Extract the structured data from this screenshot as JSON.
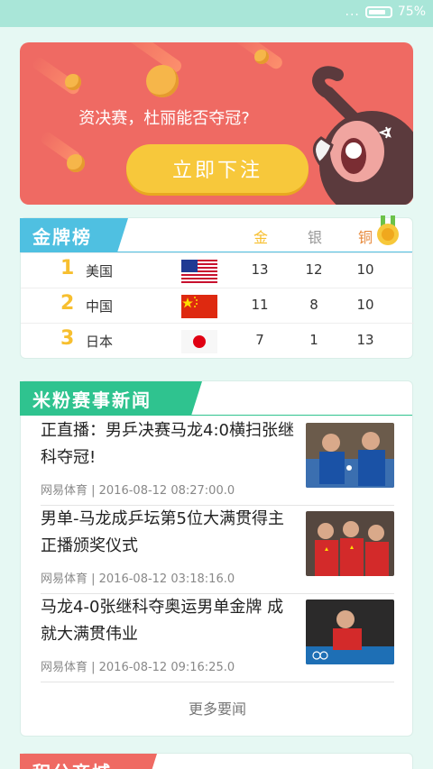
{
  "status": {
    "battery_text": "75%",
    "signal_dots": "..."
  },
  "banner": {
    "question": "资决赛，杜丽能否夺冠?",
    "bet_button": "立即下注"
  },
  "medals": {
    "title": "金牌榜",
    "headers": {
      "gold": "金",
      "silver": "银",
      "bronze": "铜"
    },
    "rows": [
      {
        "rank": "1",
        "country": "美国",
        "flag": "usa-flag",
        "gold": "13",
        "silver": "12",
        "bronze": "10"
      },
      {
        "rank": "2",
        "country": "中国",
        "flag": "china-flag",
        "gold": "11",
        "silver": "8",
        "bronze": "10"
      },
      {
        "rank": "3",
        "country": "日本",
        "flag": "japan-flag",
        "gold": "7",
        "silver": "1",
        "bronze": "13"
      }
    ]
  },
  "news": {
    "title": "米粉赛事新闻",
    "items": [
      {
        "title": "正直播：男乒决赛马龙4:0横扫张继科夺冠!",
        "meta": "网易体育 | 2016-08-12 08:27:00.0"
      },
      {
        "title": "男单-马龙成乒坛第5位大满贯得主 正播颁奖仪式",
        "meta": "网易体育 | 2016-08-12 03:18:16.0"
      },
      {
        "title": "马龙4-0张继科夺奥运男单金牌 成就大满贯伟业",
        "meta": "网易体育 | 2016-08-12 09:16:25.0"
      }
    ],
    "more_label": "更多要闻"
  },
  "shop": {
    "title": "积分商城"
  },
  "colors": {
    "banner_red": "#ef6a63",
    "button_yellow": "#f7c83b",
    "medal_blue": "#4fc0e1",
    "news_green": "#2fc38f",
    "gold": "#f7bf2f",
    "silver": "#999999",
    "bronze": "#e7893c"
  }
}
